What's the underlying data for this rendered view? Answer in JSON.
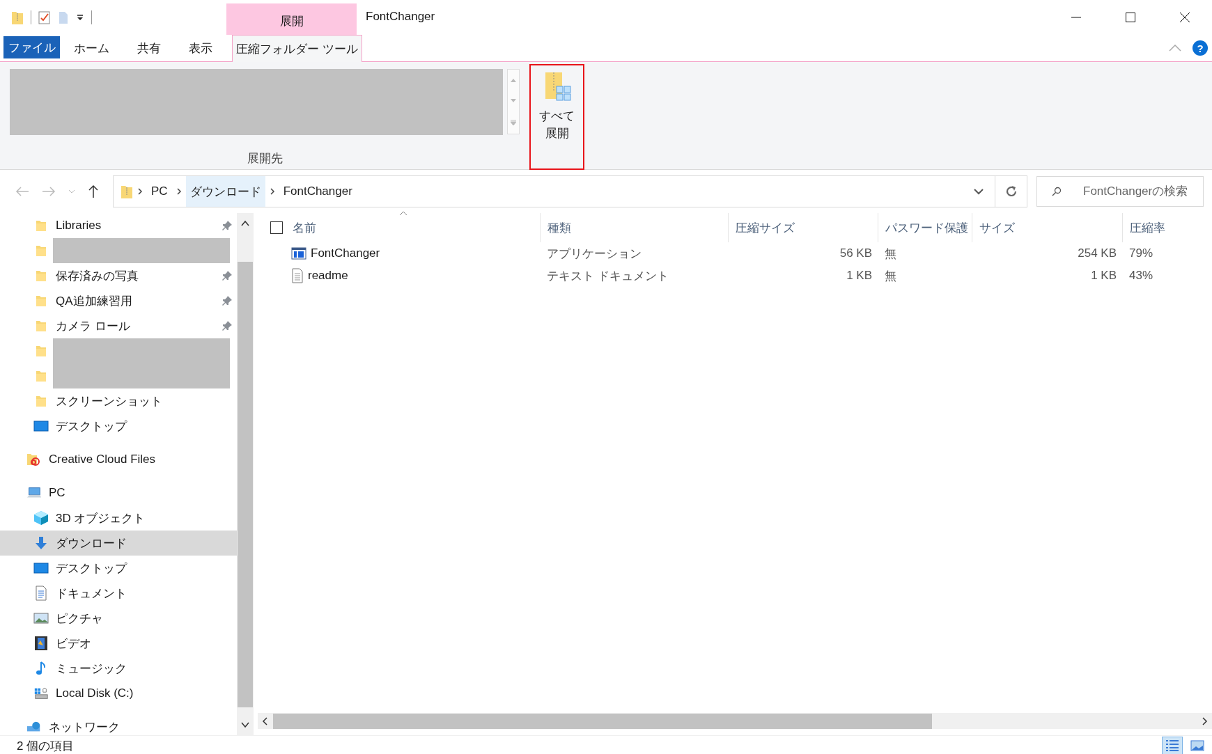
{
  "window": {
    "title": "FontChanger",
    "context_tab_group": "展開"
  },
  "ribbon_tabs": [
    {
      "label": "ファイル",
      "kind": "file",
      "selected": false
    },
    {
      "label": "ホーム",
      "kind": "tab",
      "selected": false
    },
    {
      "label": "共有",
      "kind": "tab",
      "selected": false
    },
    {
      "label": "表示",
      "kind": "tab",
      "selected": false
    },
    {
      "label": "圧縮フォルダー ツール",
      "kind": "context",
      "selected": true
    }
  ],
  "help_button": "?",
  "ribbon": {
    "group_label": "展開先",
    "extract_all": {
      "lines": [
        "すべて",
        "展開"
      ],
      "highlighted": true
    }
  },
  "address_bar": {
    "crumbs": [
      {
        "label": "PC",
        "selected": false
      },
      {
        "label": "ダウンロード",
        "selected": true
      },
      {
        "label": "FontChanger",
        "selected": false
      }
    ],
    "search": {
      "placeholder": "FontChangerの検索"
    }
  },
  "sidebar": {
    "pinned_group": [
      {
        "label": "Libraries",
        "kind": "folder",
        "pinned": true,
        "redacted": false,
        "selected": false
      },
      {
        "kind": "folder",
        "redacted": true,
        "selected": false
      },
      {
        "label": "保存済みの写真",
        "kind": "folder",
        "pinned": true,
        "redacted": false,
        "selected": false
      },
      {
        "label": "QA追加練習用",
        "kind": "folder",
        "pinned": true,
        "redacted": false,
        "selected": false
      },
      {
        "label": "カメラ ロール",
        "kind": "folder",
        "pinned": true,
        "redacted": false,
        "selected": false
      },
      {
        "kind": "folder",
        "redacted": true,
        "selected": false
      },
      {
        "kind": "folder",
        "redacted": true,
        "selected": false
      },
      {
        "label": "スクリーンショット",
        "kind": "folder",
        "pinned": false,
        "redacted": false,
        "selected": false
      },
      {
        "label": "デスクトップ",
        "kind": "desktop",
        "pinned": false,
        "redacted": false,
        "selected": false
      }
    ],
    "tree": [
      {
        "label": "Creative Cloud Files",
        "kind": "cloud-folder",
        "selected": false
      },
      {
        "label": "PC",
        "kind": "pc",
        "selected": false,
        "children": [
          {
            "label": "3D オブジェクト",
            "kind": "cube",
            "selected": false
          },
          {
            "label": "ダウンロード",
            "kind": "download",
            "selected": true
          },
          {
            "label": "デスクトップ",
            "kind": "desktop",
            "selected": false
          },
          {
            "label": "ドキュメント",
            "kind": "document",
            "selected": false
          },
          {
            "label": "ピクチャ",
            "kind": "picture",
            "selected": false
          },
          {
            "label": "ビデオ",
            "kind": "video",
            "selected": false
          },
          {
            "label": "ミュージック",
            "kind": "music",
            "selected": false
          },
          {
            "label": "Local Disk (C:)",
            "kind": "disk",
            "selected": false
          }
        ]
      },
      {
        "label": "ネットワーク",
        "kind": "network",
        "selected": false
      }
    ]
  },
  "file_list": {
    "select_all_checked": false,
    "columns": [
      "名前",
      "種類",
      "圧縮サイズ",
      "パスワード保護",
      "サイズ",
      "圧縮率"
    ],
    "rows": [
      {
        "kind": "application",
        "cells": [
          "FontChanger",
          "アプリケーション",
          "56 KB",
          "無",
          "254 KB",
          "79%"
        ]
      },
      {
        "kind": "text",
        "cells": [
          "readme",
          "テキスト ドキュメント",
          "1 KB",
          "無",
          "1 KB",
          "43%"
        ]
      }
    ]
  },
  "status_bar": {
    "item_count": "2 個の項目",
    "views": [
      {
        "kind": "details",
        "selected": true
      },
      {
        "kind": "large-icons",
        "selected": false
      }
    ]
  }
}
